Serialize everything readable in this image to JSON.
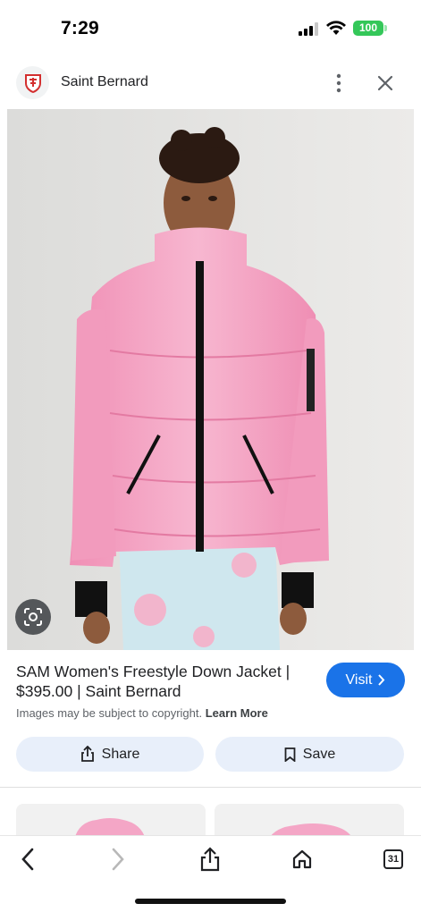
{
  "status_bar": {
    "time": "7:29",
    "battery": "100",
    "battery_color": "#34c759"
  },
  "header": {
    "site_name": "Saint Bernard",
    "logo_icon": "saint-bernard-shield-icon",
    "more_icon": "more-vert-icon",
    "close_icon": "close-icon"
  },
  "image": {
    "description_icon": "lens-icon"
  },
  "product": {
    "title": "SAM Women's Freestyle Down Jacket | $395.00 | Saint Bernard",
    "visit_label": "Visit",
    "copyright_text": "Images may be subject to copyright.",
    "learn_more": "Learn More"
  },
  "actions": {
    "share_label": "Share",
    "save_label": "Save"
  },
  "toolbar": {
    "back_icon": "chevron-left-icon",
    "forward_icon": "chevron-right-icon",
    "share_icon": "share-icon",
    "home_icon": "home-icon",
    "tabs_count": "31"
  },
  "colors": {
    "accent": "#1a73e8",
    "jacket": "#f4a6c6",
    "button_bg": "#e8effa"
  }
}
